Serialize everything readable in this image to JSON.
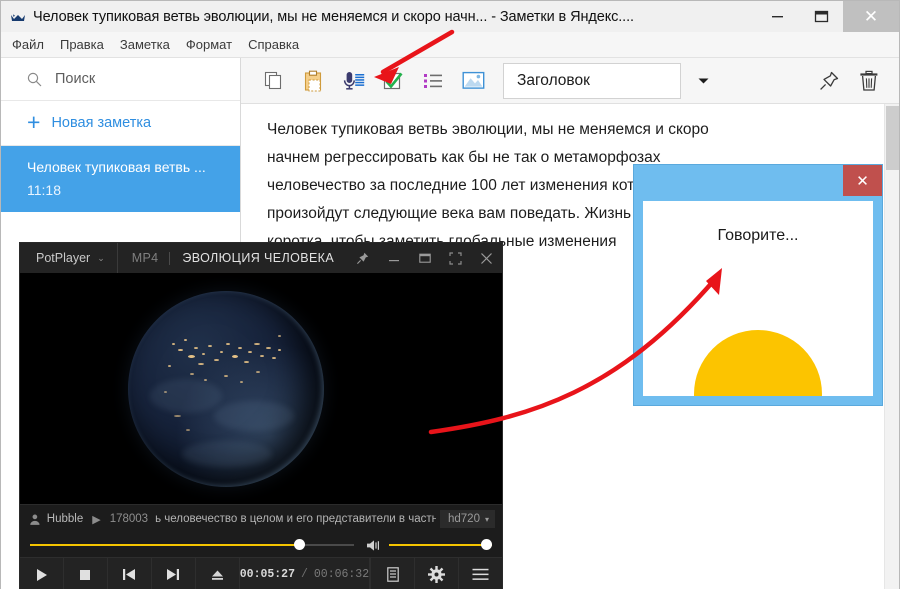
{
  "app": {
    "title": "Человек тупиковая ветвь эволюции, мы не меняемся и скоро начн... - Заметки в Яндекс....",
    "icon": "yandex-notes-icon",
    "window_buttons": {
      "minimize": "minimize-icon",
      "maximize": "maximize-icon",
      "close": "✕"
    },
    "menu": [
      "Файл",
      "Правка",
      "Заметка",
      "Формат",
      "Справка"
    ]
  },
  "sidebar": {
    "search": {
      "icon": "search-icon",
      "placeholder": "Поиск",
      "value": "Поиск"
    },
    "new_note": {
      "icon": "plus-icon",
      "label": "Новая заметка"
    },
    "notes": [
      {
        "title": "Человек тупиковая ветвь ...",
        "time": "11:18",
        "selected": true
      }
    ]
  },
  "toolbar": {
    "buttons": [
      {
        "name": "copy-icon",
        "title": "Копировать"
      },
      {
        "name": "paste-icon",
        "title": "Вставить"
      },
      {
        "name": "microphone-icon",
        "title": "Голосовой ввод"
      },
      {
        "name": "checkbox-icon",
        "title": "Список дел"
      },
      {
        "name": "bullet-list-icon",
        "title": "Маркированный список"
      },
      {
        "name": "image-icon",
        "title": "Изображение"
      }
    ],
    "style_select": {
      "value": "Заголовок",
      "caret": "▾"
    },
    "pin": {
      "name": "pin-icon"
    },
    "trash": {
      "name": "trash-icon"
    }
  },
  "editor": {
    "lines": [
      "Человек тупиковая ветвь эволюции, мы не меняемся и скоро",
      "начнем регрессировать как бы не так о метаморфозах",
      "человечество за последние 100 лет изменения которые",
      "произойдут следующие века вам поведать. Жизнь человека",
      "коротка, чтобы заметить глобальные изменения"
    ]
  },
  "potplayer": {
    "brand": "PotPlayer",
    "brand_caret": "⌄",
    "format": "MP4",
    "media_title": "ЭВОЛЮЦИЯ ЧЕЛОВЕКА",
    "title_buttons": [
      "pin-icon",
      "minimize-icon",
      "restore-icon",
      "fullscreen-icon",
      "close-icon"
    ],
    "info": {
      "user_icon": "user-icon",
      "user": "Hubble",
      "play_glyph": "▶",
      "number": "178003",
      "subtitle": "ь человечество в целом и его представители в частности,",
      "quality": "hd720",
      "quality_caret": "▾"
    },
    "seek": {
      "progress_percent": 83,
      "volume_percent": 100
    },
    "controls": {
      "play": "▶",
      "stop": "■",
      "prev": "⏮",
      "next": "⏭",
      "eject": "⏏",
      "playlist_icon": "playlist-icon",
      "settings_icon": "gear-icon",
      "menu_icon": "hamburger-icon"
    },
    "time": {
      "current": "00:05:27",
      "separator": "/",
      "total": "00:06:32"
    }
  },
  "speech_dialog": {
    "close_label": "✕",
    "message": "Говорите...",
    "blob_color": "#fcc400",
    "frame_color": "#6fbdef"
  },
  "annotations": {
    "arrow_to_microphone": "red-arrow-straight",
    "arrow_to_speech_dialog": "red-arrow-curved",
    "color": "#e8141a"
  }
}
